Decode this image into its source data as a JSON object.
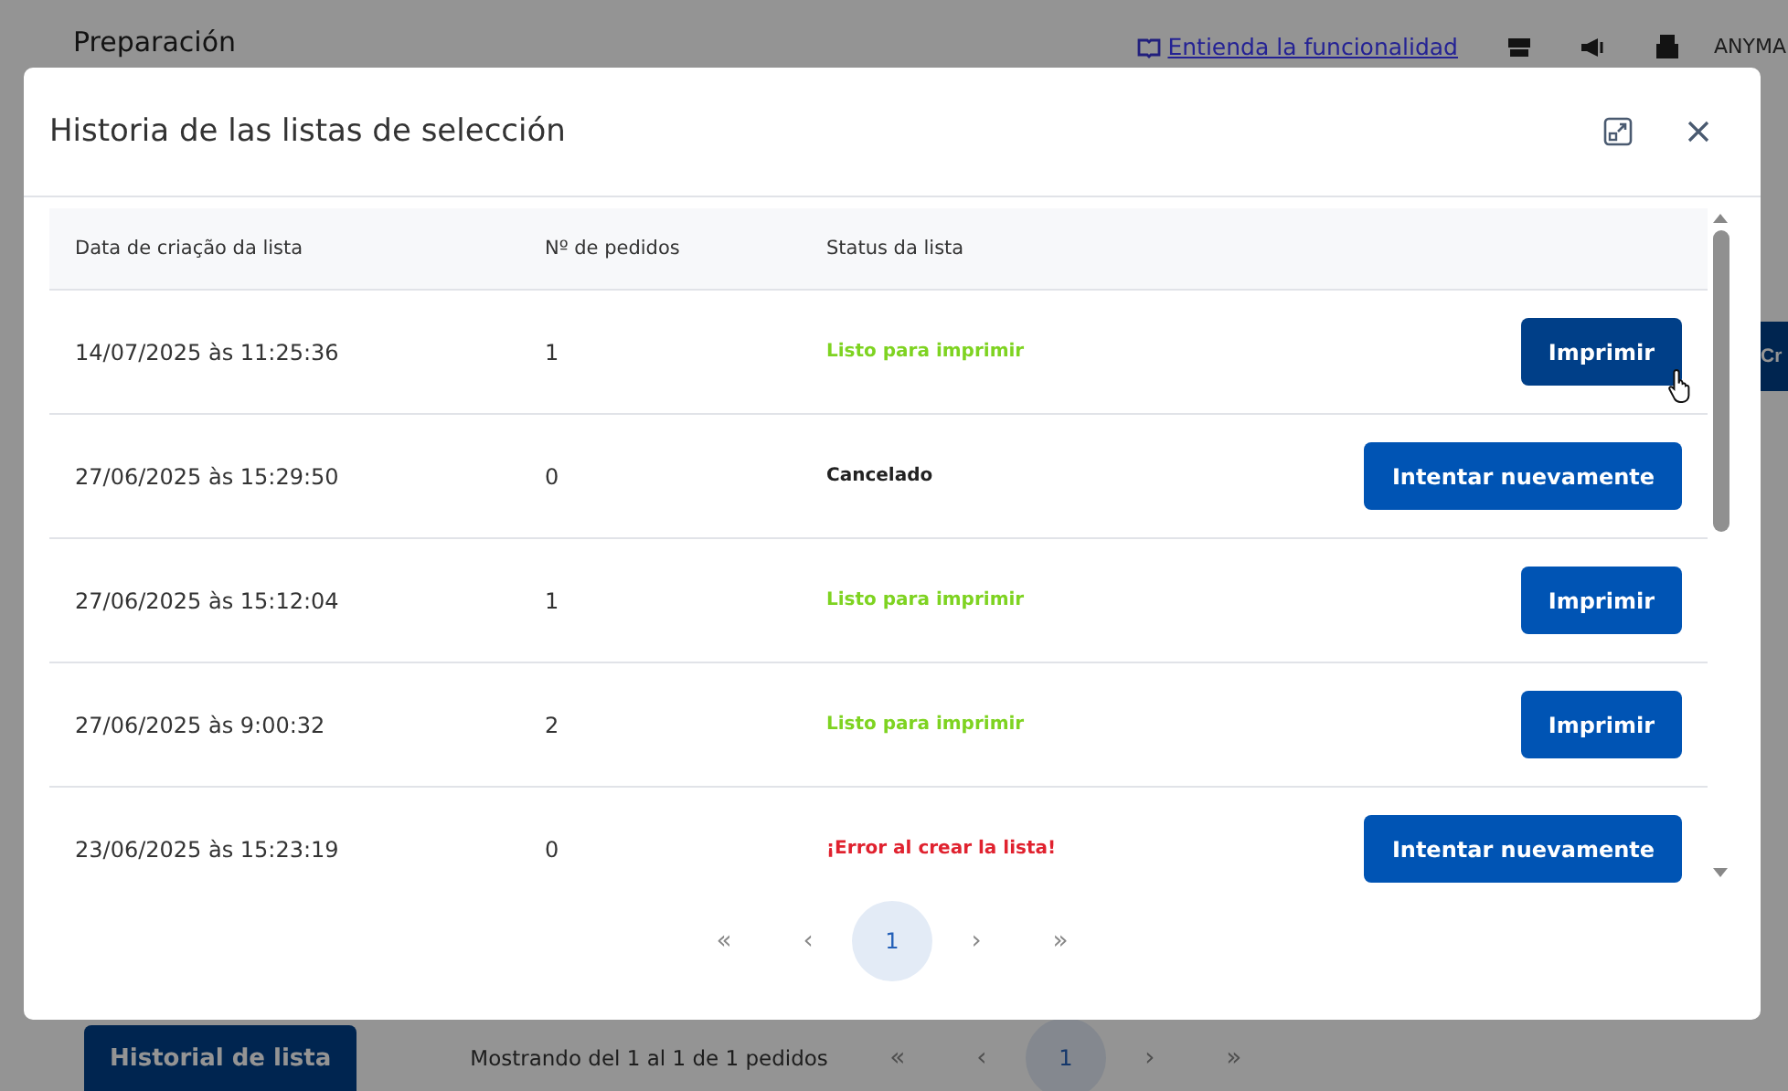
{
  "background": {
    "title": "Preparación",
    "help_link": "Entienda la funcionalidad",
    "account": "ANYMA",
    "side_button": "Cr",
    "history_button": "Historial de lista",
    "summary": "Mostrando del 1 al 1 de 1 pedidos",
    "pagination": [
      {
        "label": "«",
        "selected": false
      },
      {
        "label": "‹",
        "selected": false
      },
      {
        "label": "1",
        "selected": true
      },
      {
        "label": "›",
        "selected": false
      },
      {
        "label": "»",
        "selected": false
      }
    ]
  },
  "modal": {
    "title": "Historia de las listas de selección",
    "columns": [
      "Data de criação da lista",
      "Nº de pedidos",
      "Status da lista"
    ],
    "rows": [
      {
        "date": "14/07/2025 às 11:25:36",
        "orders": "1",
        "status": "Listo para imprimir",
        "kind": "ready",
        "action": "Imprimir",
        "hovered": true
      },
      {
        "date": "27/06/2025 às 15:29:50",
        "orders": "0",
        "status": "Cancelado",
        "kind": "cancelled",
        "action": "Intentar nuevamente",
        "hovered": false
      },
      {
        "date": "27/06/2025 às 15:12:04",
        "orders": "1",
        "status": "Listo para imprimir",
        "kind": "ready",
        "action": "Imprimir",
        "hovered": false
      },
      {
        "date": "27/06/2025 às 9:00:32",
        "orders": "2",
        "status": "Listo para imprimir",
        "kind": "ready",
        "action": "Imprimir",
        "hovered": false
      },
      {
        "date": "23/06/2025 às 15:23:19",
        "orders": "0",
        "status": "¡Error al crear la lista!",
        "kind": "error",
        "action": "Intentar nuevamente",
        "hovered": false
      }
    ],
    "pagination": [
      {
        "label": "«",
        "selected": false
      },
      {
        "label": "‹",
        "selected": false
      },
      {
        "label": "1",
        "selected": true
      },
      {
        "label": "›",
        "selected": false
      },
      {
        "label": "»",
        "selected": false
      }
    ]
  }
}
